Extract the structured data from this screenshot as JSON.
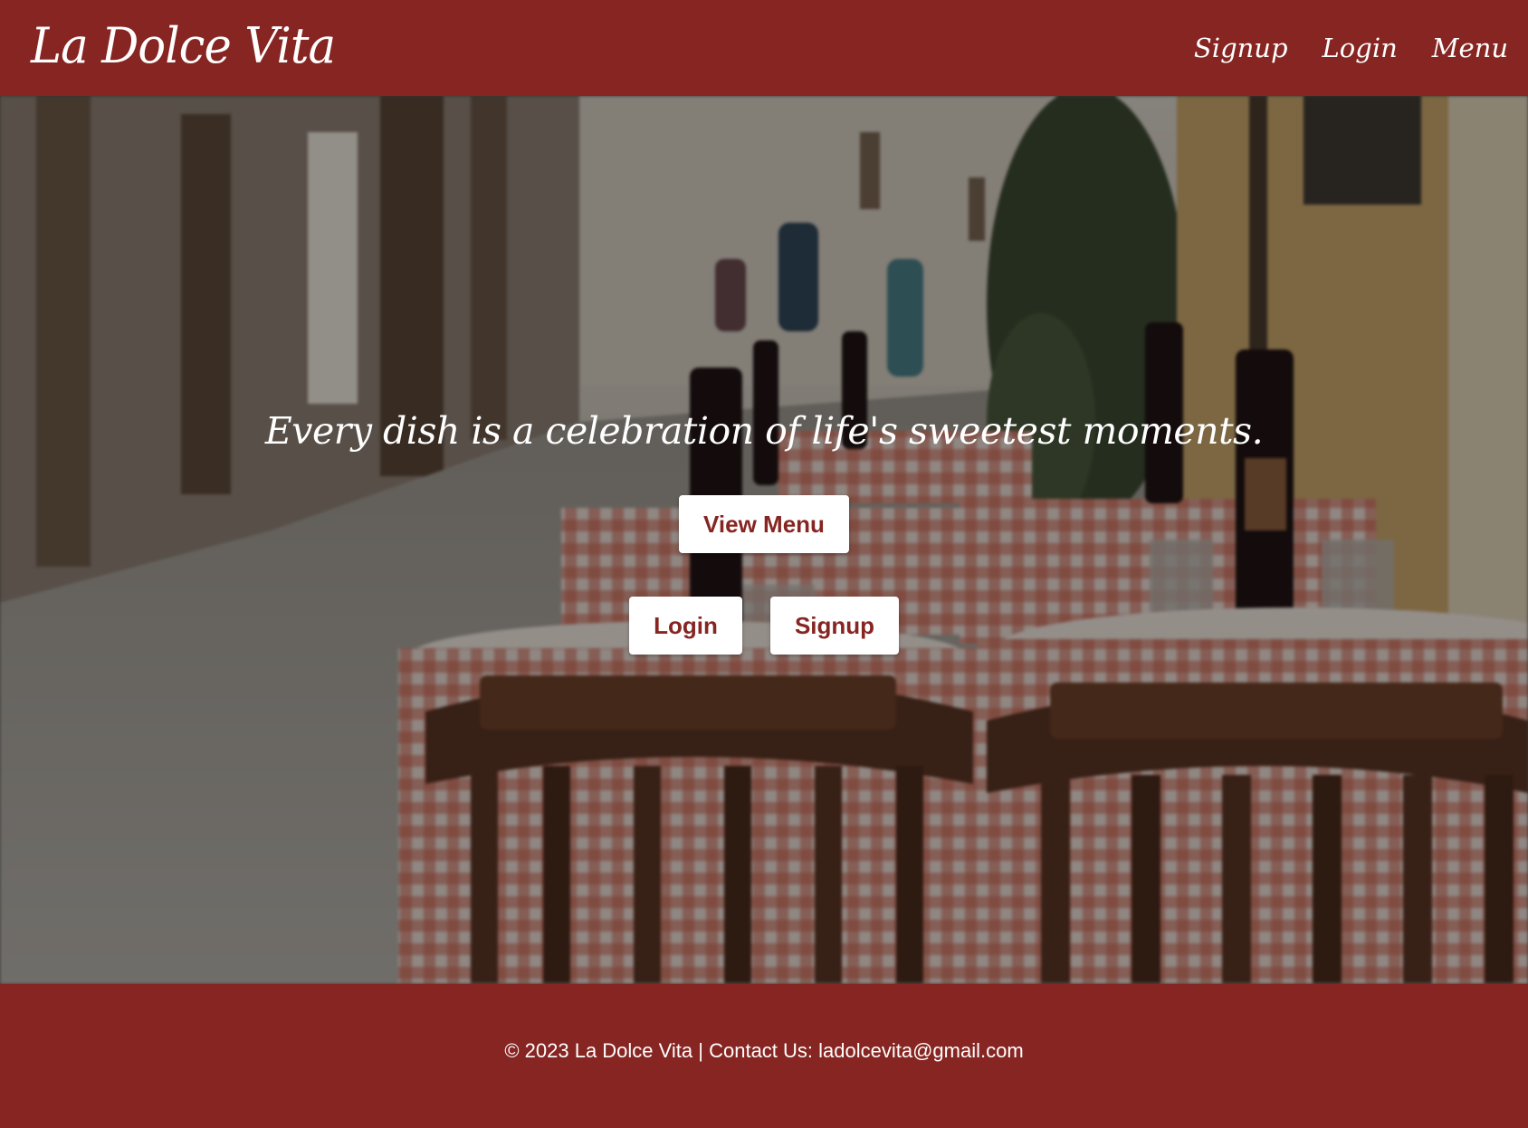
{
  "header": {
    "logo": "La Dolce Vita",
    "nav": {
      "signup": "Signup",
      "login": "Login",
      "menu": "Menu"
    }
  },
  "hero": {
    "tagline": "Every dish is a celebration of life's sweetest moments.",
    "buttons": {
      "view_menu": "View Menu",
      "login": "Login",
      "signup": "Signup"
    }
  },
  "footer": {
    "text": "© 2023 La Dolce Vita | Contact Us: ladolcevita@gmail.com"
  },
  "colors": {
    "brand": "#862521",
    "button_bg": "#ffffff",
    "button_text": "#862521"
  }
}
